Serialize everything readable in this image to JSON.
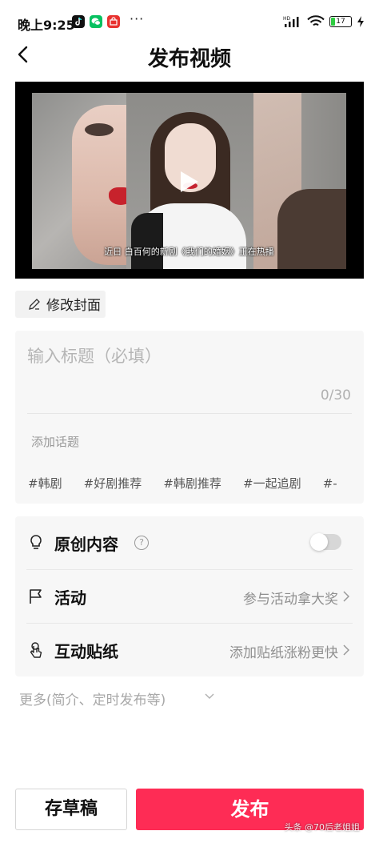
{
  "status_bar": {
    "time": "晚上9:25",
    "dots": "···",
    "network_label": "HD",
    "battery": "17"
  },
  "header": {
    "title": "发布视频"
  },
  "video": {
    "subtitle": "近日 白百何的新剧《我们的婚姻》正在热播"
  },
  "cover": {
    "edit_label": "修改封面"
  },
  "title_input": {
    "placeholder": "输入标题（必填）",
    "count": "0/30",
    "add_topic": "添加话题",
    "tags": [
      "#韩剧",
      "#好剧推荐",
      "#韩剧推荐",
      "#一起追剧",
      "#-"
    ]
  },
  "settings": {
    "original": {
      "label": "原创内容",
      "help": "?",
      "enabled": false
    },
    "activity": {
      "label": "活动",
      "value": "参与活动拿大奖"
    },
    "sticker": {
      "label": "互动贴纸",
      "value": "添加贴纸涨粉更快"
    }
  },
  "more": {
    "label": "更多(简介、定时发布等)"
  },
  "actions": {
    "draft": "存草稿",
    "publish": "发布"
  },
  "watermark": "头条 @70后老姐姐",
  "colors": {
    "accent": "#fe2c55",
    "card_bg": "#f7f7f7"
  }
}
